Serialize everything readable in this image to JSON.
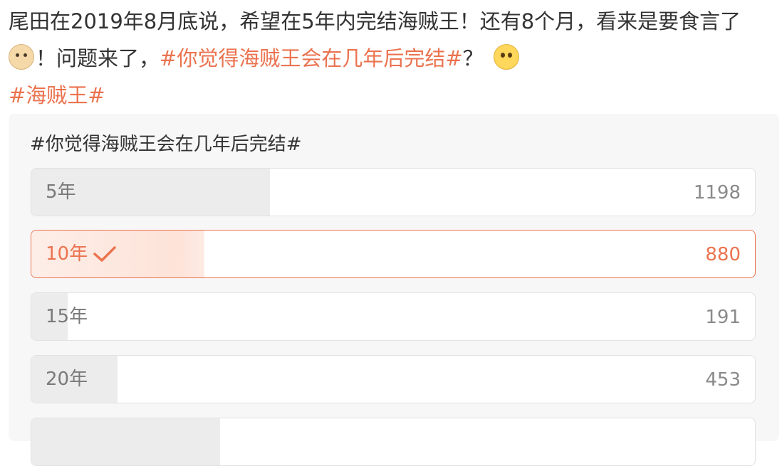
{
  "post": {
    "line1": "尾田在2019年8月底说，希望在5年内完结海贼王！还有8个月，看来是要食言了",
    "line2_pre": "！问题来了，",
    "line2_tag": "#你觉得海贼王会在几年后完结#",
    "line2_post": "？",
    "line3_tag": "#海贼王#",
    "emoji_1": "dog-emoji",
    "emoji_2": "thinking-emoji",
    "tag_color": "#eb7350"
  },
  "poll": {
    "title": "#你觉得海贼王会在几年后完结#",
    "options": [
      {
        "label": "5年",
        "count": "1198",
        "selected": false,
        "fraction": 0.33
      },
      {
        "label": "10年",
        "count": "880",
        "selected": true,
        "fraction": 0.24
      },
      {
        "label": "15年",
        "count": "191",
        "selected": false,
        "fraction": 0.05
      },
      {
        "label": "20年",
        "count": "453",
        "selected": false,
        "fraction": 0.12
      }
    ],
    "selected_color": "#eb7350",
    "check_icon": "checkmark-icon"
  }
}
